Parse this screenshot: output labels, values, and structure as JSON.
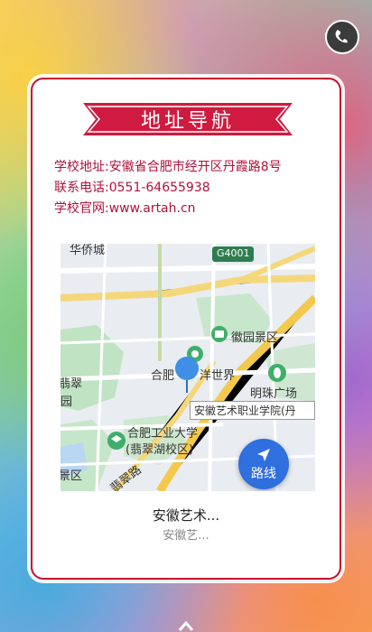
{
  "header": {
    "music_button_icon": "music-note-icon"
  },
  "card": {
    "title": "地址导航",
    "address": "学校地址:安徽省合肥市经开区丹霞路8号",
    "phone": "联系电话:0551-64655938",
    "website": "学校官网:www.artah.cn"
  },
  "map": {
    "labels": {
      "huaqiao": "华侨城",
      "g4001": "G4001",
      "huiyuan": "徽园景区",
      "hefei_world": "合肥",
      "hefei_world2": "洋世界",
      "mingzhu": "明珠广场",
      "feicui_left": "翡翠",
      "yuan": "园",
      "jingqu": "景区",
      "hfut": "合肥工业大学",
      "hfut_campus": "(翡翠湖校区)",
      "feicui_road": "翡翠路",
      "destination": "安徽艺术职业学院(丹"
    },
    "route_button": "路线",
    "place_name": "安徽艺术...",
    "place_sub": "安徽艺..."
  },
  "colors": {
    "accent": "#c8102e",
    "route_blue": "#2f6fde"
  }
}
